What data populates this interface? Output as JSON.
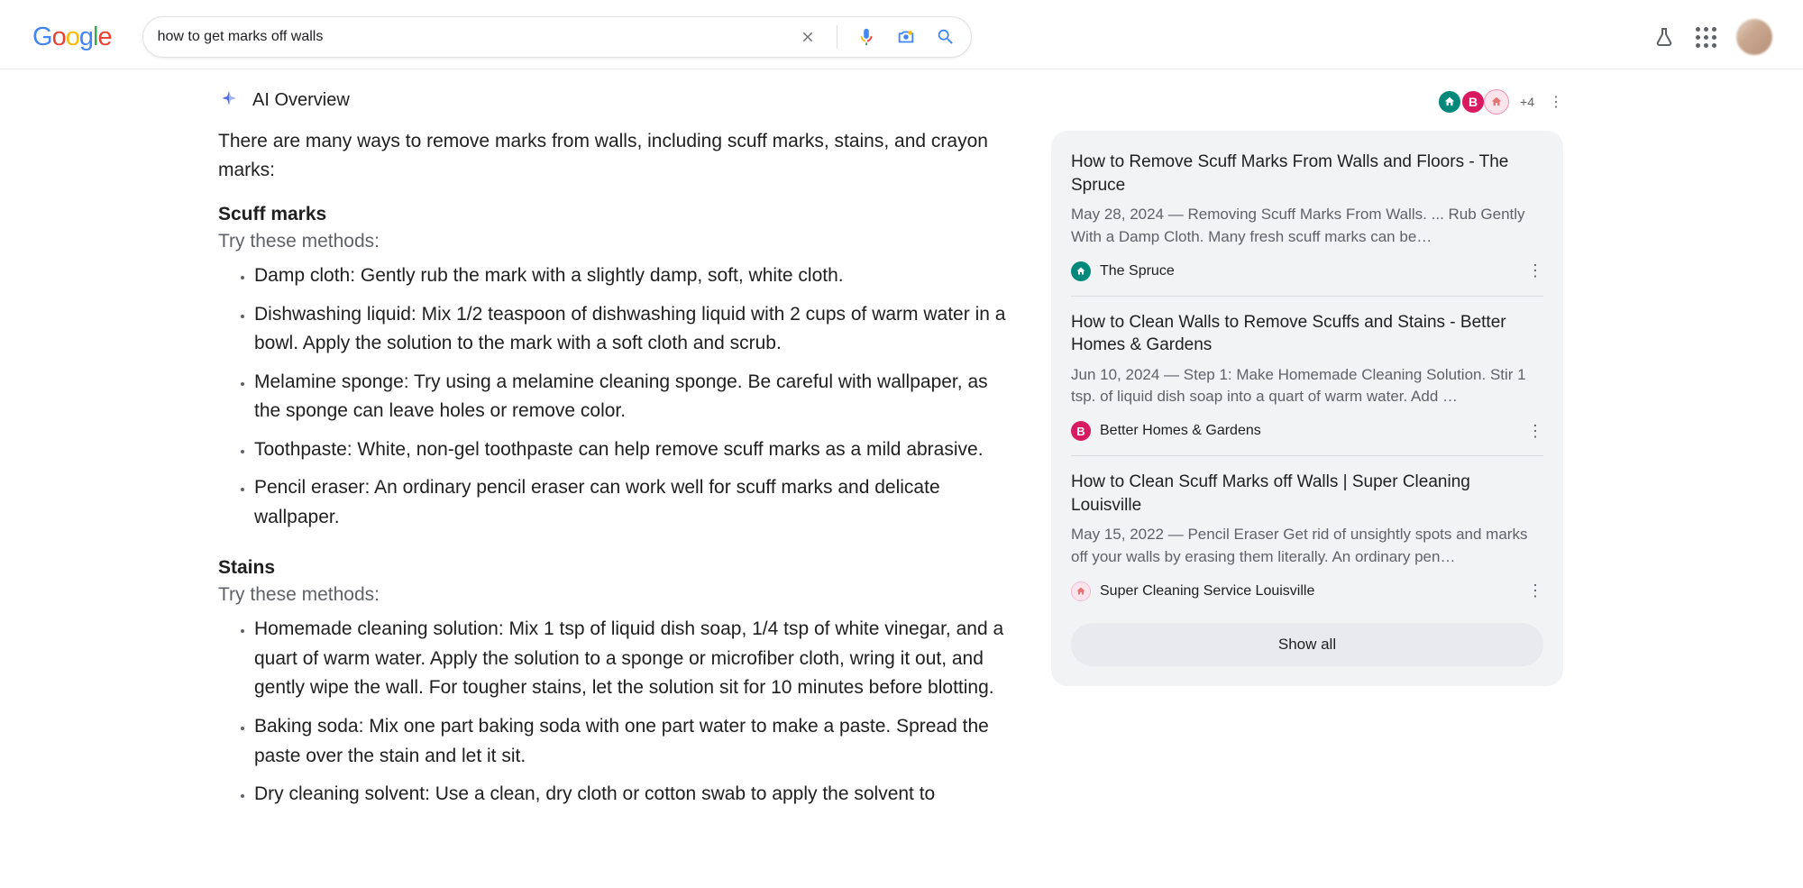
{
  "search": {
    "query": "how to get marks off walls"
  },
  "ai": {
    "label": "AI Overview",
    "plus_count": "+4",
    "intro": "There are many ways to remove marks from walls, including scuff marks, stains, and crayon marks:",
    "sections": [
      {
        "heading": "Scuff marks",
        "try": "Try these methods:",
        "items": [
          "Damp cloth: Gently rub the mark with a slightly damp, soft, white cloth.",
          "Dishwashing liquid: Mix 1/2 teaspoon of dishwashing liquid with 2 cups of warm water in a bowl. Apply the solution to the mark with a soft cloth and scrub.",
          "Melamine sponge: Try using a melamine cleaning sponge. Be careful with wallpaper, as the sponge can leave holes or remove color.",
          "Toothpaste: White, non-gel toothpaste can help remove scuff marks as a mild abrasive.",
          "Pencil eraser: An ordinary pencil eraser can work well for scuff marks and delicate wallpaper."
        ]
      },
      {
        "heading": "Stains",
        "try": "Try these methods:",
        "items": [
          "Homemade cleaning solution: Mix 1 tsp of liquid dish soap, 1/4 tsp of white vinegar, and a quart of warm water. Apply the solution to a sponge or microfiber cloth, wring it out, and gently wipe the wall. For tougher stains, let the solution sit for 10 minutes before blotting.",
          "Baking soda: Mix one part baking soda with one part water to make a paste. Spread the paste over the stain and let it sit.",
          "Dry cleaning solvent: Use a clean, dry cloth or cotton swab to apply the solvent to"
        ]
      }
    ]
  },
  "sources": [
    {
      "title": "How to Remove Scuff Marks From Walls and Floors - The Spruce",
      "snippet": "May 28, 2024 — Removing Scuff Marks From Walls. ... Rub Gently With a Damp Cloth. Many fresh scuff marks can be…",
      "name": "The Spruce",
      "favicon_bg": "#00897b",
      "favicon_glyph": "⌂"
    },
    {
      "title": "How to Clean Walls to Remove Scuffs and Stains - Better Homes & Gardens",
      "snippet": "Jun 10, 2024 — Step 1: Make Homemade Cleaning Solution. Stir 1 tsp. of liquid dish soap into a quart of warm water. Add …",
      "name": "Better Homes & Gardens",
      "favicon_bg": "#d81b60",
      "favicon_glyph": "B"
    },
    {
      "title": "How to Clean Scuff Marks off Walls | Super Cleaning Louisville",
      "snippet": "May 15, 2022 — Pencil Eraser Get rid of unsightly spots and marks off your walls by erasing them literally. An ordinary pen…",
      "name": "Super Cleaning Service Louisville",
      "favicon_bg": "#fce4ec",
      "favicon_glyph": "⌂"
    }
  ],
  "show_all": "Show all"
}
